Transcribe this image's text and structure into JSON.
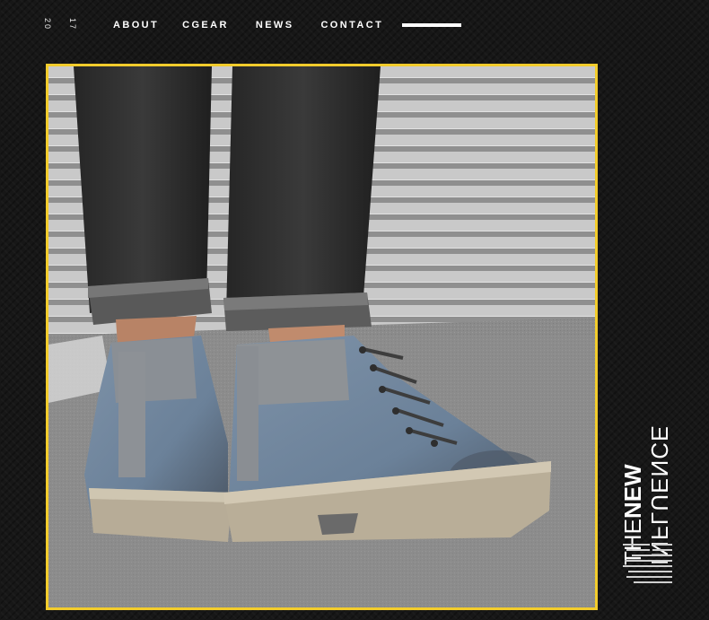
{
  "header": {
    "year_top": "20",
    "year_bottom": "17",
    "nav": [
      {
        "label": "ABOUT"
      },
      {
        "label": "CGEAR"
      },
      {
        "label": "NEWS"
      },
      {
        "label": "CONTACT"
      }
    ]
  },
  "colors": {
    "frame": "#f2cc2c",
    "background": "#171717",
    "text": "#ffffff"
  },
  "photo": {
    "subject": "boots-photo"
  },
  "side": {
    "the": "THE",
    "new": "NEW",
    "influence": "INFLUENCE"
  }
}
